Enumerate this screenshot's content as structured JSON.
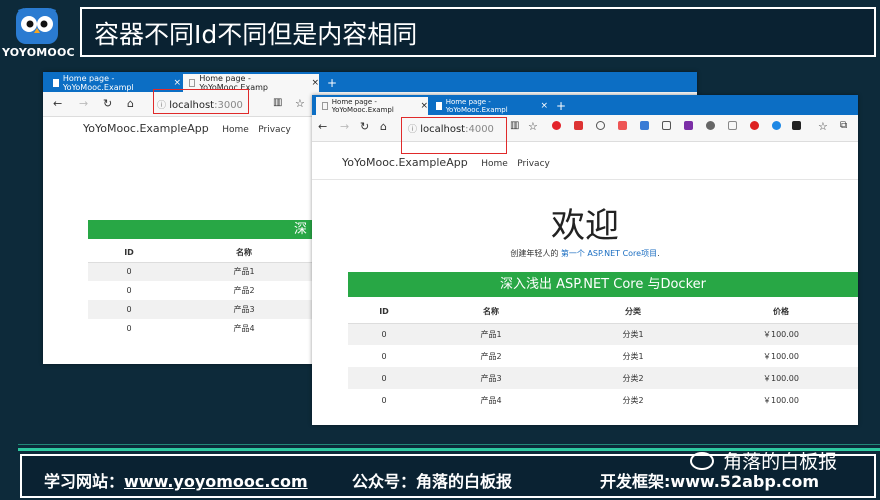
{
  "header": {
    "logo_text": "YOYOMOOC",
    "title": "容器不同Id不同但是内容相同"
  },
  "window_left": {
    "tabs": [
      {
        "label": "Home page - YoYoMooc.Exampl"
      },
      {
        "label": "Home page - YoYoMooc.Examp"
      }
    ],
    "address_host": "localhost",
    "address_port": ":3000",
    "brand": "YoYoMooc.ExampleApp",
    "nav": [
      "Home",
      "Privacy"
    ],
    "banner": "深入",
    "columns": [
      "ID",
      "名称"
    ],
    "rows": [
      [
        "0",
        "产品1"
      ],
      [
        "0",
        "产品2"
      ],
      [
        "0",
        "产品3"
      ],
      [
        "0",
        "产品4"
      ]
    ]
  },
  "window_right": {
    "tabs": [
      {
        "label": "Home page - YoYoMooc.Exampl"
      },
      {
        "label": "Home page - YoYoMooc.Exampl"
      }
    ],
    "address_host": "localhost",
    "address_port": ":4000",
    "brand": "YoYoMooc.ExampleApp",
    "nav": [
      "Home",
      "Privacy"
    ],
    "welcome": "欢迎",
    "subtitle_prefix": "创建年轻人的",
    "subtitle_link": "第一个 ASP.NET Core项目",
    "subtitle_suffix": ".",
    "banner": "深入浅出 ASP.NET Core 与Docker",
    "columns": [
      "ID",
      "名称",
      "分类",
      "价格"
    ],
    "rows": [
      [
        "0",
        "产品1",
        "分类1",
        "￥100.00"
      ],
      [
        "0",
        "产品2",
        "分类1",
        "￥100.00"
      ],
      [
        "0",
        "产品3",
        "分类2",
        "￥100.00"
      ],
      [
        "0",
        "产品4",
        "分类2",
        "￥100.00"
      ]
    ]
  },
  "footer": {
    "site_label": "学习网站：",
    "site_url": "www.yoyomooc.com",
    "wechat": "公众号：角落的白板报",
    "framework_label": "开发框架:",
    "framework_url": "www.52abp.com"
  },
  "watermark": "角落的白板报",
  "colors": {
    "background": "#0d2a3a",
    "accent": "#2ec9a0",
    "banner_green": "#28a745",
    "tab_blue": "#0c6ec4",
    "highlight_red": "#e02a2a"
  }
}
